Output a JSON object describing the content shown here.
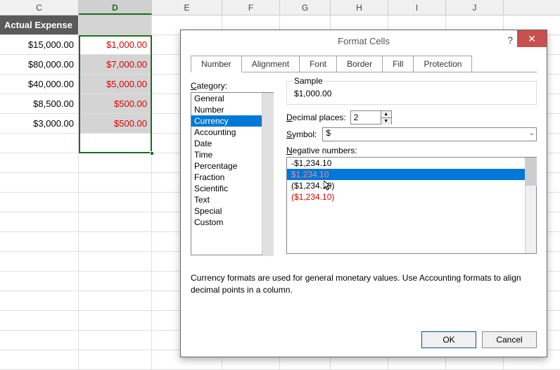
{
  "columns": [
    {
      "letter": "C",
      "cls": "col-w-c"
    },
    {
      "letter": "D",
      "cls": "col-w-d",
      "selected": true
    },
    {
      "letter": "E",
      "cls": "col-w-e"
    },
    {
      "letter": "F",
      "cls": "col-w-f"
    },
    {
      "letter": "G",
      "cls": "col-w-g"
    },
    {
      "letter": "H",
      "cls": "col-w-h"
    },
    {
      "letter": "I",
      "cls": "col-w-i"
    },
    {
      "letter": "J",
      "cls": "col-w-j"
    }
  ],
  "sheet": {
    "header_label": "Actual Expense",
    "rows": [
      {
        "c": "$15,000.00",
        "d": "$1,000.00"
      },
      {
        "c": "$80,000.00",
        "d": "$7,000.00"
      },
      {
        "c": "$40,000.00",
        "d": "$5,000.00"
      },
      {
        "c": "$8,500.00",
        "d": "$500.00"
      },
      {
        "c": "$3,000.00",
        "d": "$500.00"
      }
    ]
  },
  "dialog": {
    "title": "Format Cells",
    "tabs": [
      "Number",
      "Alignment",
      "Font",
      "Border",
      "Fill",
      "Protection"
    ],
    "active_tab": 0,
    "category_label": "Category:",
    "categories": [
      "General",
      "Number",
      "Currency",
      "Accounting",
      "Date",
      "Time",
      "Percentage",
      "Fraction",
      "Scientific",
      "Text",
      "Special",
      "Custom"
    ],
    "selected_category": 2,
    "sample_label": "Sample",
    "sample_value": "$1,000.00",
    "decimal_label_pre": "D",
    "decimal_label_mid": "ecimal places:",
    "decimal_value": "2",
    "symbol_label_pre": "S",
    "symbol_label_mid": "ymbol:",
    "symbol_value": "$",
    "neg_label_pre": "N",
    "neg_label_mid": "egative numbers:",
    "neg_items": [
      {
        "text": "-$1,234.10",
        "red": false
      },
      {
        "text": "$1,234.10",
        "red": true,
        "selected": true
      },
      {
        "text": "($1,234.10)",
        "red": false
      },
      {
        "text": "($1,234.10)",
        "red": true
      }
    ],
    "description": "Currency formats are used for general monetary values.  Use Accounting formats to align decimal points in a column.",
    "ok_label": "OK",
    "cancel_label": "Cancel"
  }
}
